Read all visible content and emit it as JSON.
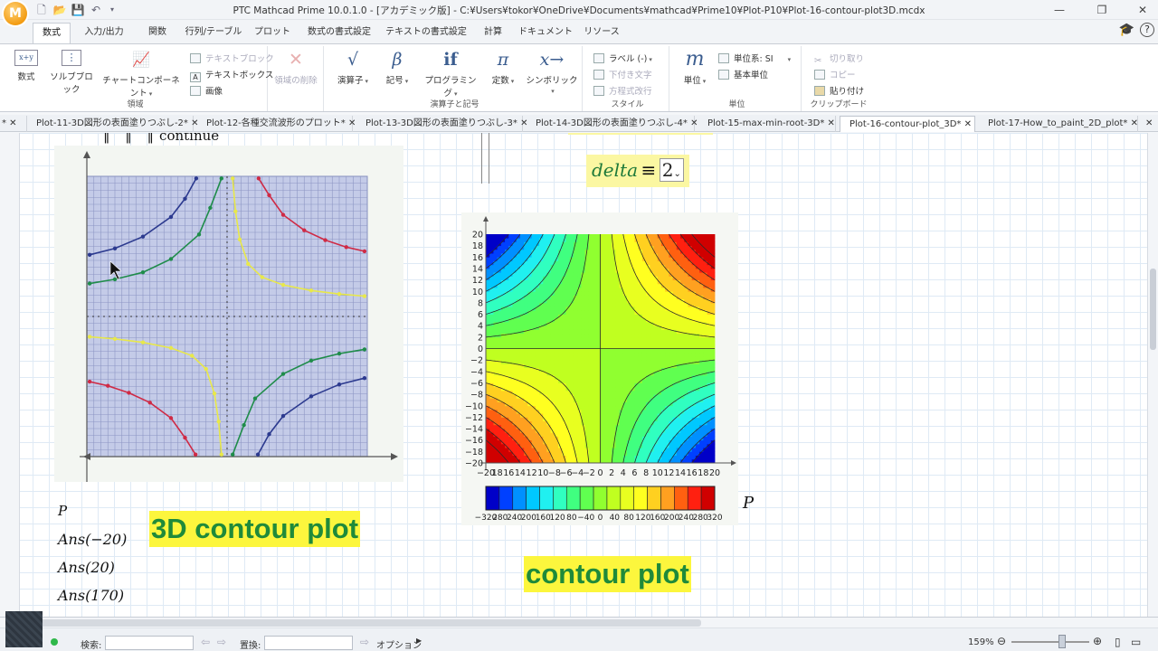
{
  "titlebar": {
    "title": "PTC Mathcad Prime 10.0.1.0 - [アカデミック版] - C:¥Users¥tokor¥OneDrive¥Documents¥mathcad¥Prime10¥Plot-P10¥Plot-16-contour-plot3D.mcdx",
    "logo": "M"
  },
  "ribbon_tabs": [
    "数式",
    "入力/出力",
    "関数",
    "行列/テーブル",
    "プロット",
    "数式の書式設定",
    "テキストの書式設定",
    "計算",
    "ドキュメント",
    "リソース"
  ],
  "ribbon": {
    "regions": {
      "label": "領域",
      "math": "数式",
      "solve_block": "ソルブブロック",
      "chart_component": "チャートコンポーネント",
      "text_block": "テキストブロック",
      "text_box": "テキストボックス",
      "image": "画像",
      "delete_region": "領域の削除"
    },
    "operators": {
      "label": "演算子と記号",
      "operators": "演算子",
      "symbols": "記号",
      "programming": "プログラミング",
      "constants": "定数",
      "symbolics": "シンボリック"
    },
    "style": {
      "label": "スタイル",
      "label_btn": "ラベル (-)",
      "subscript": "下付き文字",
      "equation_break": "方程式改行"
    },
    "units": {
      "label": "単位",
      "units": "単位",
      "unit_system": "単位系: SI",
      "base_unit": "基本単位"
    },
    "clipboard": {
      "label": "クリップボード",
      "cut": "切り取り",
      "copy": "コピー",
      "paste": "貼り付け"
    }
  },
  "doc_tabs": [
    "Plot-11-3D図形の表面塗りつぶし-2*",
    "Plot-12-各種交流波形のプロット*",
    "Plot-13-3D図形の表面塗りつぶし-3*",
    "Plot-14-3D図形の表面塗りつぶし-4*",
    "Plot-15-max-min-root-3D*",
    "Plot-16-contour-plot_3D*",
    "Plot-17-How_to_paint_2D_plot*"
  ],
  "worksheet": {
    "continue_text": "continue",
    "delta_name": "delta",
    "delta_def": "≡",
    "delta_value": "2",
    "p_var": "P",
    "ans_lines": [
      "Ans(−20)",
      "Ans(20)",
      "Ans(170)"
    ],
    "title_3d": "3D contour plot",
    "title_contour": "contour plot",
    "contour_p": "P"
  },
  "chart_data": [
    {
      "type": "scatter",
      "series": [
        {
          "color": "#2c3a8f",
          "points": [
            [
              -19.6,
              8.8
            ],
            [
              -16,
              9.7
            ],
            [
              -12,
              11.4
            ],
            [
              -8,
              14.2
            ],
            [
              -6,
              16.8
            ],
            [
              -4.4,
              19.7
            ]
          ]
        },
        {
          "color": "#2c3a8f",
          "points": [
            [
              4.4,
              -19.7
            ],
            [
              6,
              -16.8
            ],
            [
              8,
              -14.2
            ],
            [
              12,
              -11.4
            ],
            [
              16,
              -9.7
            ],
            [
              19.6,
              -8.8
            ]
          ]
        },
        {
          "color": "#1f8c4a",
          "points": [
            [
              -19.6,
              4.7
            ],
            [
              -16,
              5.3
            ],
            [
              -12,
              6.3
            ],
            [
              -8,
              8.2
            ],
            [
              -4,
              11.7
            ],
            [
              -2.4,
              15.5
            ],
            [
              -0.8,
              19.7
            ]
          ]
        },
        {
          "color": "#1f8c4a",
          "points": [
            [
              0.8,
              -19.7
            ],
            [
              2.4,
              -15.5
            ],
            [
              4,
              -11.7
            ],
            [
              8,
              -8.2
            ],
            [
              12,
              -6.3
            ],
            [
              16,
              -5.3
            ],
            [
              19.6,
              -4.7
            ]
          ]
        },
        {
          "color": "#e8e84a",
          "points": [
            [
              0.8,
              19.7
            ],
            [
              1.2,
              15
            ],
            [
              1.8,
              11
            ],
            [
              3,
              7.5
            ],
            [
              5,
              5.6
            ],
            [
              8,
              4.5
            ],
            [
              12,
              3.7
            ],
            [
              16,
              3.2
            ],
            [
              19.6,
              2.9
            ]
          ]
        },
        {
          "color": "#e8e84a",
          "points": [
            [
              -19.6,
              -2.9
            ],
            [
              -16,
              -3.2
            ],
            [
              -12,
              -3.7
            ],
            [
              -8,
              -4.5
            ],
            [
              -5,
              -5.6
            ],
            [
              -3,
              -7.5
            ],
            [
              -1.8,
              -11
            ],
            [
              -1.2,
              -15
            ],
            [
              -0.8,
              -19.7
            ]
          ]
        },
        {
          "color": "#cf2a45",
          "points": [
            [
              4.5,
              19.7
            ],
            [
              6,
              17.3
            ],
            [
              8,
              14.5
            ],
            [
              11,
              12.3
            ],
            [
              14,
              10.9
            ],
            [
              17,
              9.9
            ],
            [
              19.6,
              9.3
            ]
          ]
        },
        {
          "color": "#cf2a45",
          "points": [
            [
              -19.6,
              -9.3
            ],
            [
              -17,
              -9.9
            ],
            [
              -14,
              -10.9
            ],
            [
              -11,
              -12.3
            ],
            [
              -8,
              -14.5
            ],
            [
              -6,
              -17.3
            ],
            [
              -4.5,
              -19.7
            ]
          ]
        }
      ],
      "xlim": [
        -20,
        20
      ],
      "ylim": [
        -20,
        20
      ]
    },
    {
      "type": "heatmap",
      "xlim": [
        -20,
        20
      ],
      "ylim": [
        -20,
        20
      ],
      "ticks": [
        -20,
        -18,
        -16,
        -14,
        -12,
        -10,
        -8,
        -6,
        -4,
        -2,
        0,
        2,
        4,
        6,
        8,
        10,
        12,
        14,
        16,
        18,
        20
      ],
      "x_tick_labels": [
        "−20",
        "18",
        "16",
        "14",
        "12",
        "10",
        "−8",
        "−6",
        "−4",
        "−2",
        "0",
        "2",
        "4",
        "6",
        "8",
        "10",
        "12",
        "14",
        "16",
        "18",
        "20"
      ],
      "y_tick_labels": [
        "−20",
        "−18",
        "−16",
        "−14",
        "−12",
        "−10",
        "−8",
        "−6",
        "−4",
        "−2",
        "0",
        "2",
        "4",
        "6",
        "8",
        "10",
        "12",
        "14",
        "16",
        "18",
        "20"
      ],
      "colorbar_labels": [
        "−320",
        "280",
        "240",
        "200",
        "160",
        "120",
        "80",
        "−40",
        "0",
        "40",
        "80",
        "120",
        "160",
        "200",
        "240",
        "280",
        "320"
      ],
      "colorbar_range": [
        -320,
        320
      ],
      "colorbar_colors": [
        "#0000c8",
        "#0040ff",
        "#0090ff",
        "#00c8ff",
        "#20f0f0",
        "#30ffc0",
        "#40ff80",
        "#60ff50",
        "#90ff30",
        "#c0ff20",
        "#e8ff20",
        "#ffff20",
        "#ffd020",
        "#ffa020",
        "#ff6010",
        "#ff2010",
        "#d00000"
      ],
      "contour_levels": [
        -320,
        -280,
        -240,
        -200,
        -160,
        -120,
        -80,
        -40,
        0,
        40,
        80,
        120,
        160,
        200,
        240,
        280,
        320
      ]
    }
  ],
  "statusbar": {
    "search_label": "検索:",
    "replace_label": "置換:",
    "options_label": "オプション",
    "zoom": "159%"
  }
}
